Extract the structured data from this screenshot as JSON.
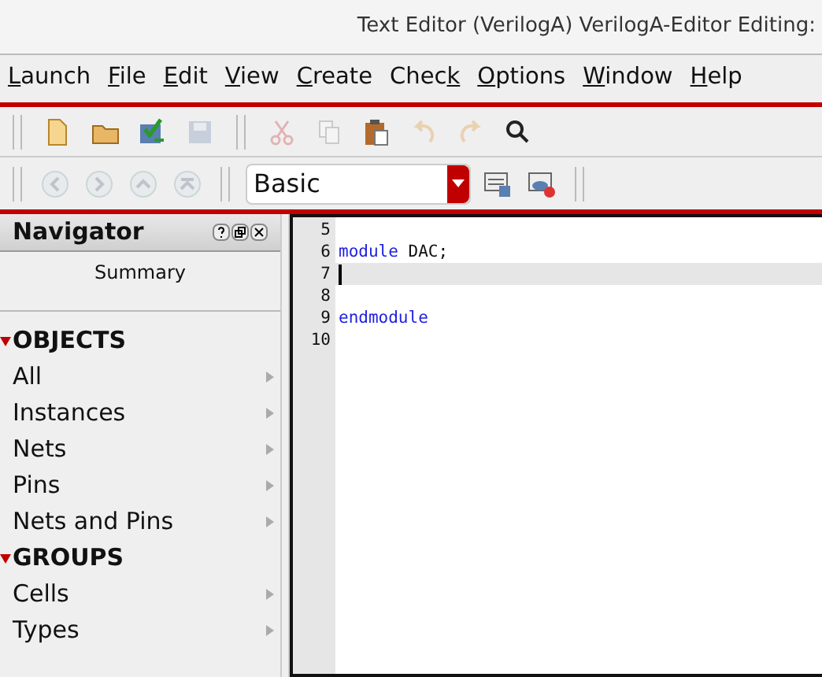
{
  "window": {
    "title": "Text Editor (VerilogA) VerilogA-Editor Editing:"
  },
  "menu": [
    {
      "key": "L",
      "post": "aunch"
    },
    {
      "key": "F",
      "post": "ile"
    },
    {
      "key": "E",
      "post": "dit"
    },
    {
      "key": "V",
      "post": "iew"
    },
    {
      "key": "C",
      "post": "reate"
    },
    {
      "pre": "Chec",
      "key": "k"
    },
    {
      "key": "O",
      "post": "ptions"
    },
    {
      "key": "W",
      "post": "indow"
    },
    {
      "key": "H",
      "post": "elp"
    }
  ],
  "toolbar": [
    {
      "kind": "new",
      "disabled": false
    },
    {
      "kind": "open",
      "disabled": false
    },
    {
      "kind": "check-save",
      "disabled": false
    },
    {
      "kind": "save",
      "disabled": true
    },
    {
      "kind": "sep"
    },
    {
      "kind": "cut",
      "disabled": true
    },
    {
      "kind": "copy",
      "disabled": true
    },
    {
      "kind": "paste",
      "disabled": false
    },
    {
      "kind": "undo",
      "disabled": true
    },
    {
      "kind": "redo",
      "disabled": true
    },
    {
      "kind": "search",
      "disabled": false
    }
  ],
  "nav_toolbar": {
    "buttons": [
      {
        "kind": "back",
        "disabled": true
      },
      {
        "kind": "forward",
        "disabled": true
      },
      {
        "kind": "up",
        "disabled": true
      },
      {
        "kind": "top",
        "disabled": true
      }
    ],
    "combo": {
      "value": "Basic"
    },
    "actions": [
      {
        "kind": "window-save",
        "disabled": false
      },
      {
        "kind": "window-view",
        "disabled": false
      }
    ]
  },
  "navigator": {
    "title": "Navigator",
    "summary": "Summary",
    "sections": [
      {
        "label": "OBJECTS",
        "expanded": true,
        "items": [
          "All",
          "Instances",
          "Nets",
          "Pins",
          "Nets and Pins"
        ]
      },
      {
        "label": "GROUPS",
        "expanded": true,
        "items": [
          "Cells",
          "Types"
        ]
      }
    ]
  },
  "editor": {
    "lines": [
      {
        "number": "5",
        "current": false
      },
      {
        "number": "6",
        "current": false,
        "tokens": [
          {
            "kind": "keyword",
            "text": "module"
          },
          {
            "kind": "plain",
            "text": " DAC;"
          }
        ]
      },
      {
        "number": "7",
        "current": true
      },
      {
        "number": "8",
        "current": false
      },
      {
        "number": "9",
        "current": false,
        "tokens": [
          {
            "kind": "keyword",
            "text": "endmodule"
          }
        ]
      },
      {
        "number": "10",
        "current": false
      }
    ]
  }
}
